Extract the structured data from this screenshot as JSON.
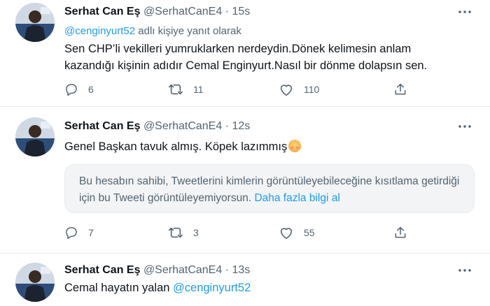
{
  "colors": {
    "link": "#1d9bf0",
    "secondary_text": "#536471",
    "primary_text": "#0f1419",
    "separator": "#e6ecf0"
  },
  "tweets": [
    {
      "name": "Serhat Can Eş",
      "handle": "@SerhatCanE4",
      "dot": "·",
      "time": "15s",
      "reply_mention": "@cenginyurt52",
      "reply_suffix": " adlı kişiye yanıt olarak",
      "text_line1": "Sen CHP’li vekilleri  yumruklarken nerdeydin.Dönek kelimesin anlam",
      "text_line2": "kazandığı kişinin adıdır Cemal Enginyurt.Nasıl bir dönme dolapsın sen.",
      "reply_count": "6",
      "retweet_count": "11",
      "like_count": "110"
    },
    {
      "name": "Serhat Can Eş",
      "handle": "@SerhatCanE4",
      "dot": "·",
      "time": "12s",
      "text": "Genel Başkan tavuk almış. Köpek lazımmış",
      "emoji": "smiling-face-emoji",
      "notice_text": "Bu hesabın sahibi, Tweetlerini kimlerin görüntüleyebileceğine kısıtlama getirdiği için bu Tweeti görüntüleyemiyorsun.",
      "notice_link": "Daha fazla bilgi al",
      "reply_count": "7",
      "retweet_count": "3",
      "like_count": "55"
    },
    {
      "name": "Serhat Can Eş",
      "handle": "@SerhatCanE4",
      "dot": "·",
      "time": "13s",
      "text": "Cemal hayatın yalan ",
      "mention": "@cenginyurt52"
    }
  ],
  "icons": {
    "more": "more-icon",
    "reply": "reply-icon",
    "retweet": "retweet-icon",
    "like": "like-icon",
    "share": "share-icon"
  }
}
